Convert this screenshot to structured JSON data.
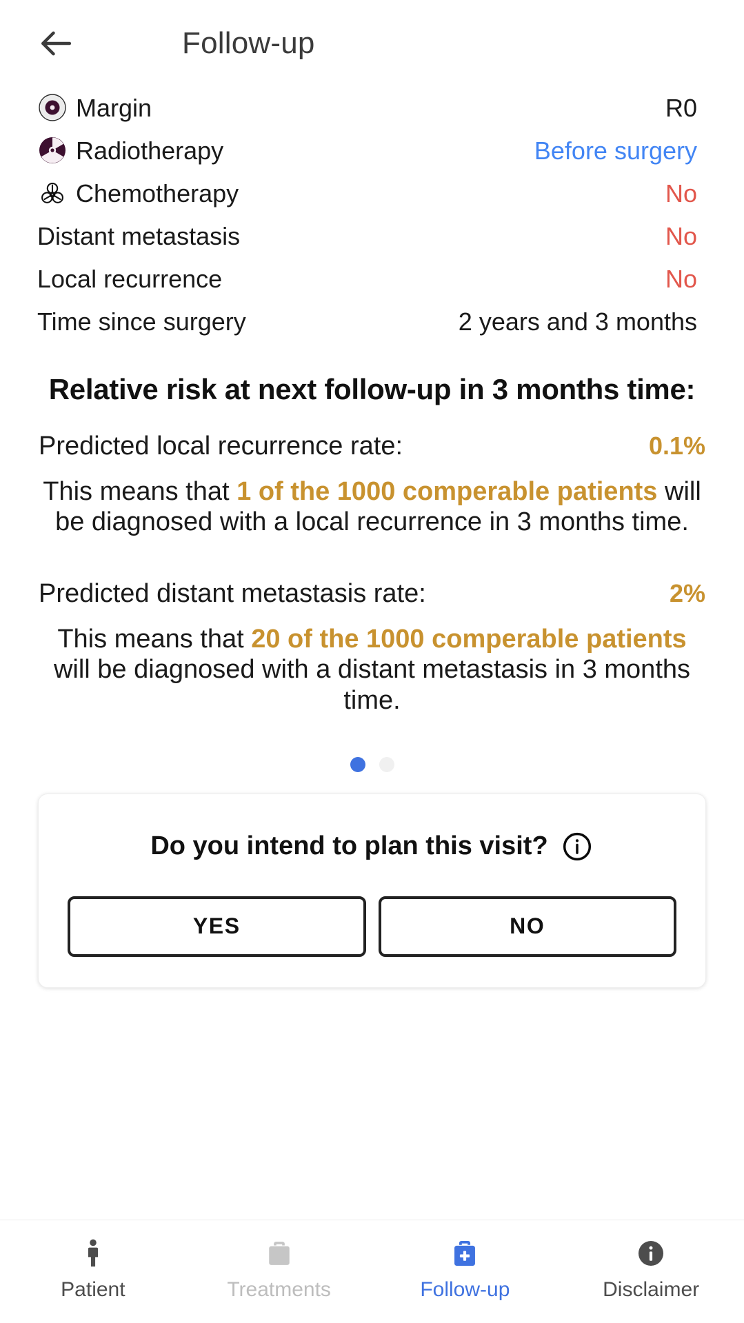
{
  "appbar": {
    "back_icon": "arrow-left-icon",
    "title": "Follow-up"
  },
  "info_rows": [
    {
      "icon": "target-margin-icon",
      "label": "Margin",
      "value": "R0",
      "value_color": "#1a1a1a"
    },
    {
      "icon": "radioactive-icon",
      "label": "Radiotherapy",
      "value": "Before surgery",
      "value_color": "#4285f4"
    },
    {
      "icon": "biohazard-icon",
      "label": "Chemotherapy",
      "value": "No",
      "value_color": "#e2574c"
    },
    {
      "icon": null,
      "label": "Distant metastasis",
      "value": "No",
      "value_color": "#e2574c"
    },
    {
      "icon": null,
      "label": "Local recurrence",
      "value": "No",
      "value_color": "#e2574c"
    },
    {
      "icon": null,
      "label": "Time since surgery",
      "value": "2 years and 3 months",
      "value_color": "#1a1a1a"
    }
  ],
  "risk": {
    "heading": "Relative risk at next follow-up in 3 months time:",
    "local_recurrence": {
      "title": "Predicted local recurrence rate:",
      "rate": "0.1%",
      "expl_prefix": "This means that ",
      "expl_highlight": "1 of the 1000 comperable patients",
      "expl_suffix": " will be diagnosed with a local recurrence in 3 months time."
    },
    "distant_metastasis": {
      "title": "Predicted distant metastasis rate:",
      "rate": "2%",
      "expl_prefix": "This means that ",
      "expl_highlight": "20 of the 1000 comperable patients",
      "expl_suffix": " will be diagnosed with a distant metastasis in 3 months time."
    }
  },
  "pager": {
    "total": 2,
    "active_index": 0
  },
  "question_card": {
    "question": "Do you intend to plan this visit?",
    "info_icon": "info-circle-icon",
    "yes_label": "YES",
    "no_label": "NO"
  },
  "bottom_nav": {
    "items": [
      {
        "icon": "person-icon",
        "label": "Patient",
        "state": "normal"
      },
      {
        "icon": "briefcase-icon",
        "label": "Treatments",
        "state": "dim"
      },
      {
        "icon": "medical-bag-icon",
        "label": "Follow-up",
        "state": "active"
      },
      {
        "icon": "info-circle-filled-icon",
        "label": "Disclaimer",
        "state": "normal"
      }
    ]
  },
  "colors": {
    "accent_blue": "#3f72e0",
    "link_blue": "#4285f4",
    "danger_red": "#e2574c",
    "highlight_gold": "#c8922f",
    "icon_maroon": "#3d1030",
    "text_dark": "#1a1a1a"
  }
}
